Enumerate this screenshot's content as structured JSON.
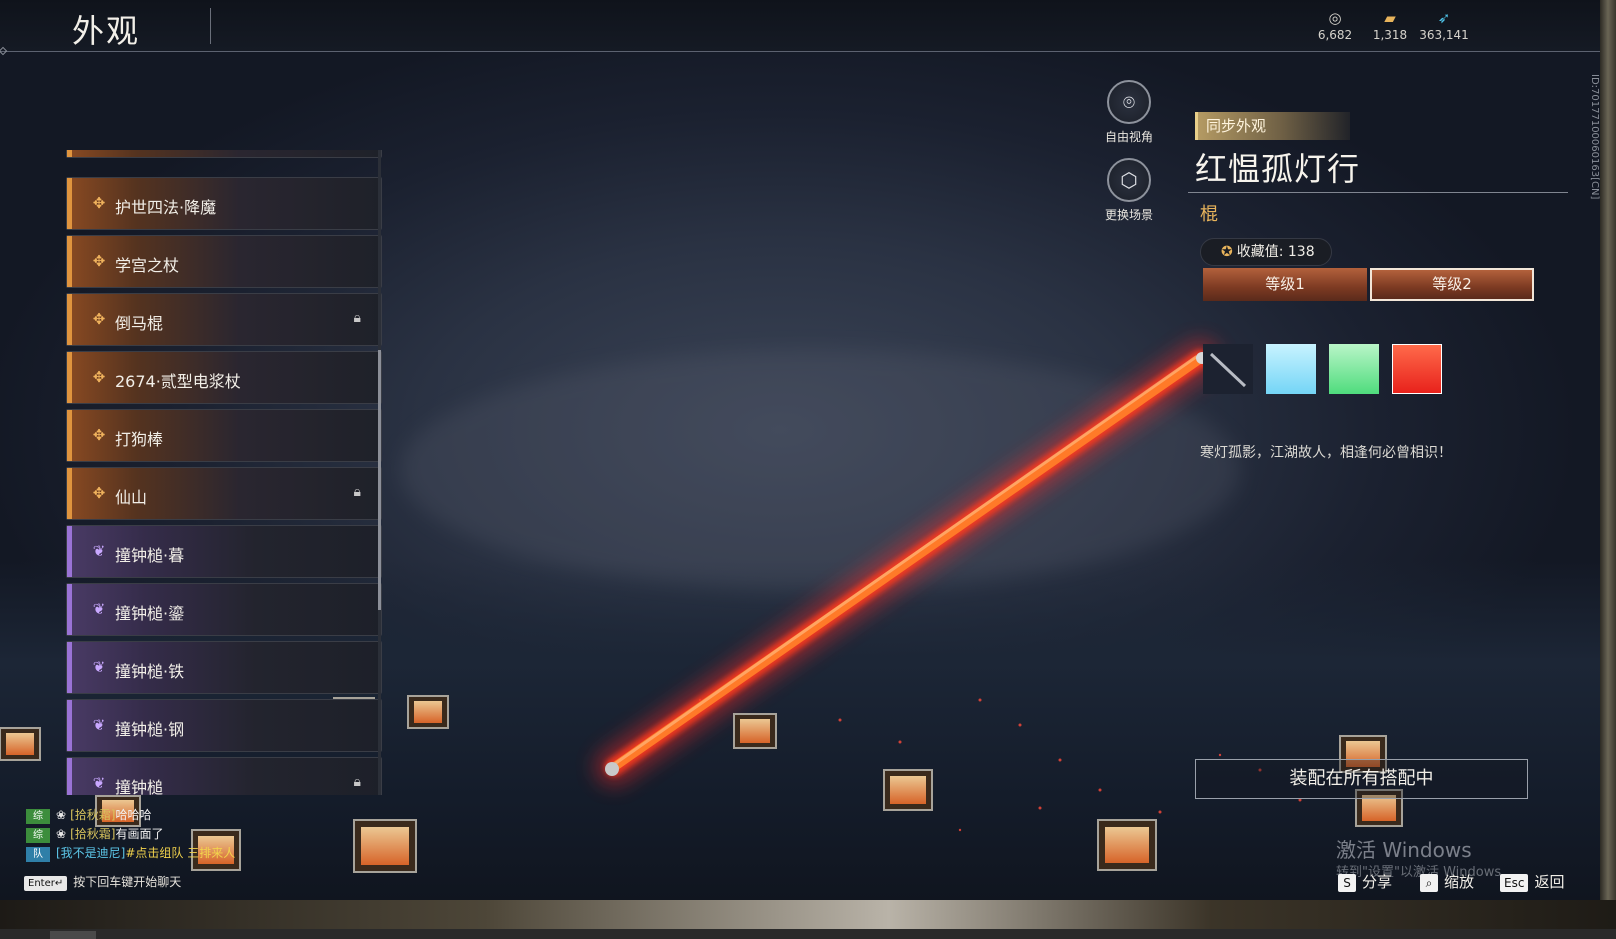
{
  "header": {
    "title": "外观",
    "currencies": [
      {
        "icon": "coin-icon",
        "value": "6,682"
      },
      {
        "icon": "ticket-icon",
        "value": "1,318"
      },
      {
        "icon": "feather-icon",
        "value": "363,141"
      }
    ]
  },
  "list": {
    "items": [
      {
        "name": "护世四法·降魔",
        "rarity": "orange",
        "locked": false
      },
      {
        "name": "学宫之杖",
        "rarity": "orange",
        "locked": false
      },
      {
        "name": "倒马棍",
        "rarity": "orange",
        "locked": true
      },
      {
        "name": "2674·贰型电浆杖",
        "rarity": "orange",
        "locked": false
      },
      {
        "name": "打狗棒",
        "rarity": "orange",
        "locked": false
      },
      {
        "name": "仙山",
        "rarity": "orange",
        "locked": true
      },
      {
        "name": "撞钟槌·暮",
        "rarity": "purple",
        "locked": false
      },
      {
        "name": "撞钟槌·鎏",
        "rarity": "purple",
        "locked": false
      },
      {
        "name": "撞钟槌·铁",
        "rarity": "purple",
        "locked": false
      },
      {
        "name": "撞钟槌·钢",
        "rarity": "purple",
        "locked": false
      },
      {
        "name": "撞钟槌",
        "rarity": "purple",
        "locked": true
      }
    ]
  },
  "side_buttons": {
    "free_view": "自由视角",
    "change_scene": "更换场景"
  },
  "detail": {
    "sync_tag": "同步外观",
    "title": "红愠孤灯行",
    "type": "棍",
    "collect_label": "收藏值: 138",
    "tiers": [
      "等级1",
      "等级2"
    ],
    "selected_tier": 1,
    "swatches": [
      {
        "name": "default",
        "color": "#1c2230"
      },
      {
        "name": "light-blue",
        "color": "#74d5f6"
      },
      {
        "name": "green",
        "color": "#4fdc7d"
      },
      {
        "name": "red",
        "color": "#e8221c"
      }
    ],
    "description": "寒灯孤影，江湖故人，相逢何必曾相识！",
    "id_text": "ID:70177100060163[CN]",
    "equip_button": "装配在所有搭配中"
  },
  "chat": {
    "lines": [
      {
        "channel": "综",
        "who": "[拾秋霜]",
        "msg": "哈哈哈",
        "team": false
      },
      {
        "channel": "综",
        "who": "[拾秋霜]",
        "msg": "有画面了",
        "team": false
      },
      {
        "channel": "队",
        "who": "[我不是迪尼]",
        "msg": "#点击组队 三排来人",
        "team": true
      }
    ],
    "enter_key": "Enter↵",
    "hint": "按下回车键开始聊天"
  },
  "hotkeys": [
    {
      "key": "S",
      "label": "分享"
    },
    {
      "key": "⌕",
      "label": "缩放"
    },
    {
      "key": "Esc",
      "label": "返回"
    }
  ],
  "watermark": {
    "line1": "激活 Windows",
    "line2": "转到\"设置\"以激活 Windows"
  },
  "colors": {
    "orange_rarity": "#e0943e",
    "purple_rarity": "#9a73d6",
    "gold_accent": "#e8b45c",
    "saber_glow": "#ff2a2a"
  }
}
